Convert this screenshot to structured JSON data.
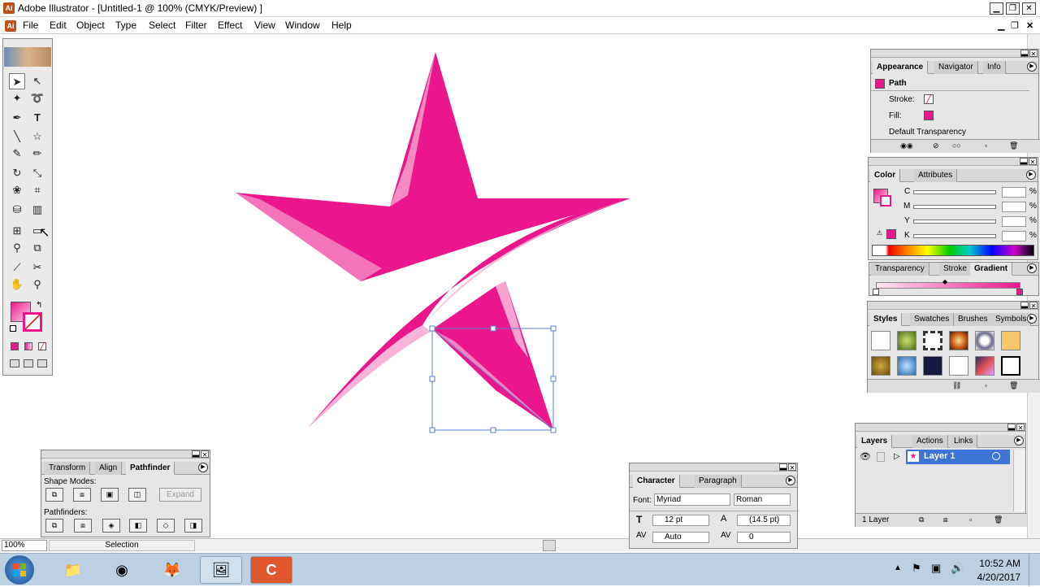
{
  "window": {
    "title": "Adobe Illustrator - [Untitled-1 @ 100% (CMYK/Preview) ]"
  },
  "menu": [
    "File",
    "Edit",
    "Object",
    "Type",
    "Select",
    "Filter",
    "Effect",
    "View",
    "Window",
    "Help"
  ],
  "colors": {
    "magenta": "#ec168c",
    "light_pink": "#f8b4d8",
    "selection_blue": "#5a7fd0",
    "layer_blue": "#3d74d6"
  },
  "appearance": {
    "tabs": [
      "Appearance",
      "Navigator",
      "Info"
    ],
    "item": "Path",
    "stroke_label": "Stroke:",
    "fill_label": "Fill:",
    "transparency": "Default Transparency"
  },
  "color_panel": {
    "tabs": [
      "Color",
      "Attributes"
    ],
    "channels": [
      "C",
      "M",
      "Y",
      "K"
    ],
    "percent": "%"
  },
  "gradient_panel": {
    "tabs": [
      "Transparency",
      "Stroke",
      "Gradient"
    ]
  },
  "styles_panel": {
    "tabs": [
      "Styles",
      "Swatches",
      "Brushes",
      "Symbols"
    ]
  },
  "layers_panel": {
    "tabs": [
      "Layers",
      "Actions",
      "Links"
    ],
    "layer_name": "Layer 1",
    "count": "1 Layer"
  },
  "pathfinder_panel": {
    "tabs": [
      "Transform",
      "Align",
      "Pathfinder"
    ],
    "shape_modes": "Shape Modes:",
    "expand": "Expand",
    "pathfinders": "Pathfinders:"
  },
  "character_panel": {
    "tabs": [
      "Character",
      "Paragraph"
    ],
    "font_label": "Font:",
    "font": "Myriad",
    "style": "Roman",
    "size": "12 pt",
    "leading": "(14.5 pt)",
    "kerning": "Auto",
    "tracking": "0"
  },
  "status": {
    "zoom": "100%",
    "tool": "Selection"
  },
  "taskbar": {
    "time": "10:52 AM",
    "date": "4/20/2017"
  }
}
